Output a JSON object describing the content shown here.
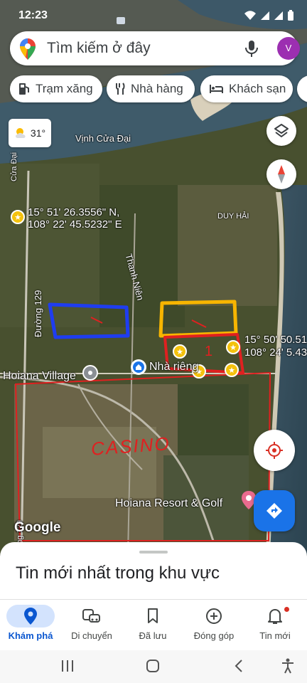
{
  "status_bar": {
    "time": "12:23"
  },
  "search": {
    "placeholder": "Tìm kiếm ở đây",
    "avatar_letter": "V"
  },
  "chips": [
    {
      "label": "Trạm xăng",
      "icon": "gas-station-icon"
    },
    {
      "label": "Nhà hàng",
      "icon": "restaurant-icon"
    },
    {
      "label": "Khách sạn",
      "icon": "hotel-icon"
    }
  ],
  "weather": {
    "temperature": "31°",
    "icon": "partly-cloudy-icon"
  },
  "map": {
    "labels": {
      "bay": "Vịnh Cửa Đại",
      "coord1_lat": "15° 51' 26.3556\" N,",
      "coord1_lng": "108° 22' 45.5232\" E",
      "coord2_lat": "15° 50' 50.51",
      "coord2_lng": "108° 24' 5.43",
      "duy_hai": "DUY HẢI",
      "street_thanh_nien": "Thanh Niên",
      "street_129": "Đường 129",
      "street_129_lower": "ờng 129",
      "cua_dai": "Cửa Đại",
      "hoiana_village": "Hoiana Village",
      "nha_rieng": "Nhà riêng",
      "hoiana_resort": "Hoiana Resort & Golf",
      "casino": "CASINO",
      "google": "Google",
      "annotation_red_number": "1"
    }
  },
  "sheet": {
    "title": "Tin mới nhất trong khu vực"
  },
  "bottom_nav": [
    {
      "label": "Khám phá",
      "icon": "explore-pin-icon",
      "active": true
    },
    {
      "label": "Di chuyển",
      "icon": "commute-icon",
      "active": false
    },
    {
      "label": "Đã lưu",
      "icon": "bookmark-icon",
      "active": false
    },
    {
      "label": "Đóng góp",
      "icon": "add-circle-icon",
      "active": false
    },
    {
      "label": "Tin mới",
      "icon": "notifications-icon",
      "active": false
    }
  ],
  "colors": {
    "accent_blue": "#1a73e8",
    "active_nav_bg": "#d3e3fd",
    "annotation_blue": "#1f3df0",
    "annotation_yellow": "#f7b500",
    "annotation_red": "#e02020",
    "avatar": "#9c2fb1"
  }
}
